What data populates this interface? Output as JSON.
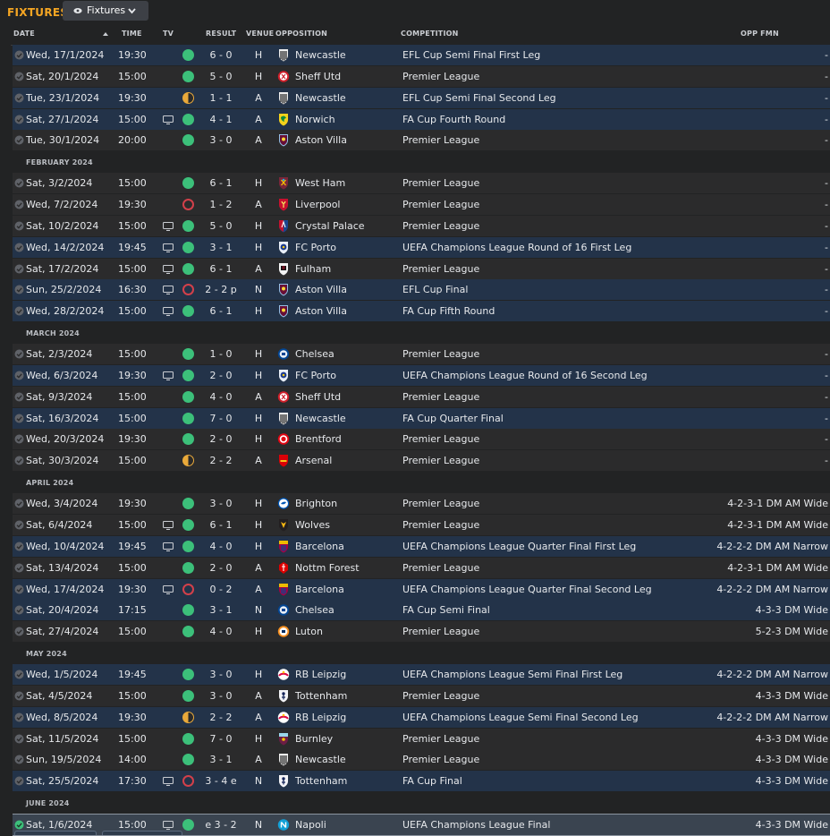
{
  "header": {
    "title": "FIXTURES",
    "view_label": "Fixtures"
  },
  "columns": {
    "date": "DATE",
    "time": "TIME",
    "tv": "TV",
    "result": "RESULT",
    "venue": "VENUE",
    "opposition": "OPPOSITION",
    "competition": "COMPETITION",
    "opp_fmn": "OPP FMN"
  },
  "colors": {
    "accent": "#f5a623",
    "win": "#3cc07a",
    "loss": "#d2404a",
    "draw": "#e9a93a",
    "highlight_row": "#233349"
  },
  "rows": [
    {
      "type": "match",
      "date": "Wed, 17/1/2024",
      "time": "19:30",
      "tv": false,
      "outcome": "win",
      "result": "6 - 0",
      "venue": "H",
      "opp": "Newcastle",
      "crest": "newcastle",
      "comp": "EFL Cup Semi Final First Leg",
      "fmn": "-",
      "hl": true
    },
    {
      "type": "match",
      "date": "Sat, 20/1/2024",
      "time": "15:00",
      "tv": false,
      "outcome": "win",
      "result": "5 - 0",
      "venue": "H",
      "opp": "Sheff Utd",
      "crest": "sheffutd",
      "comp": "Premier League",
      "fmn": "-",
      "hl": false
    },
    {
      "type": "match",
      "date": "Tue, 23/1/2024",
      "time": "19:30",
      "tv": false,
      "outcome": "draw",
      "result": "1 - 1",
      "venue": "A",
      "opp": "Newcastle",
      "crest": "newcastle",
      "comp": "EFL Cup Semi Final Second Leg",
      "fmn": "-",
      "hl": true
    },
    {
      "type": "match",
      "date": "Sat, 27/1/2024",
      "time": "15:00",
      "tv": true,
      "outcome": "win",
      "result": "4 - 1",
      "venue": "A",
      "opp": "Norwich",
      "crest": "norwich",
      "comp": "FA Cup Fourth Round",
      "fmn": "-",
      "hl": true
    },
    {
      "type": "match",
      "date": "Tue, 30/1/2024",
      "time": "20:00",
      "tv": false,
      "outcome": "win",
      "result": "3 - 0",
      "venue": "A",
      "opp": "Aston Villa",
      "crest": "villa",
      "comp": "Premier League",
      "fmn": "-",
      "hl": false
    },
    {
      "type": "month",
      "label": "FEBRUARY 2024"
    },
    {
      "type": "match",
      "date": "Sat, 3/2/2024",
      "time": "15:00",
      "tv": false,
      "outcome": "win",
      "result": "6 - 1",
      "venue": "H",
      "opp": "West Ham",
      "crest": "westham",
      "comp": "Premier League",
      "fmn": "-",
      "hl": false
    },
    {
      "type": "match",
      "date": "Wed, 7/2/2024",
      "time": "19:30",
      "tv": false,
      "outcome": "loss",
      "result": "1 - 2",
      "venue": "A",
      "opp": "Liverpool",
      "crest": "liverpool",
      "comp": "Premier League",
      "fmn": "-",
      "hl": false
    },
    {
      "type": "match",
      "date": "Sat, 10/2/2024",
      "time": "15:00",
      "tv": true,
      "outcome": "win",
      "result": "5 - 0",
      "venue": "H",
      "opp": "Crystal Palace",
      "crest": "palace",
      "comp": "Premier League",
      "fmn": "-",
      "hl": false
    },
    {
      "type": "match",
      "date": "Wed, 14/2/2024",
      "time": "19:45",
      "tv": true,
      "outcome": "win",
      "result": "3 - 1",
      "venue": "H",
      "opp": "FC Porto",
      "crest": "porto",
      "comp": "UEFA Champions League Round of 16 First Leg",
      "fmn": "-",
      "hl": true
    },
    {
      "type": "match",
      "date": "Sat, 17/2/2024",
      "time": "15:00",
      "tv": true,
      "outcome": "win",
      "result": "6 - 1",
      "venue": "A",
      "opp": "Fulham",
      "crest": "fulham",
      "comp": "Premier League",
      "fmn": "-",
      "hl": false
    },
    {
      "type": "match",
      "date": "Sun, 25/2/2024",
      "time": "16:30",
      "tv": true,
      "outcome": "loss",
      "result": "2 - 2 p",
      "venue": "N",
      "opp": "Aston Villa",
      "crest": "villa",
      "comp": "EFL Cup Final",
      "fmn": "-",
      "hl": true
    },
    {
      "type": "match",
      "date": "Wed, 28/2/2024",
      "time": "15:00",
      "tv": true,
      "outcome": "win",
      "result": "6 - 1",
      "venue": "H",
      "opp": "Aston Villa",
      "crest": "villa",
      "comp": "FA Cup Fifth Round",
      "fmn": "-",
      "hl": true
    },
    {
      "type": "month",
      "label": "MARCH 2024"
    },
    {
      "type": "match",
      "date": "Sat, 2/3/2024",
      "time": "15:00",
      "tv": false,
      "outcome": "win",
      "result": "1 - 0",
      "venue": "H",
      "opp": "Chelsea",
      "crest": "chelsea",
      "comp": "Premier League",
      "fmn": "-",
      "hl": false
    },
    {
      "type": "match",
      "date": "Wed, 6/3/2024",
      "time": "19:30",
      "tv": true,
      "outcome": "win",
      "result": "2 - 0",
      "venue": "H",
      "opp": "FC Porto",
      "crest": "porto",
      "comp": "UEFA Champions League Round of 16 Second Leg",
      "fmn": "-",
      "hl": true
    },
    {
      "type": "match",
      "date": "Sat, 9/3/2024",
      "time": "15:00",
      "tv": false,
      "outcome": "win",
      "result": "4 - 0",
      "venue": "A",
      "opp": "Sheff Utd",
      "crest": "sheffutd",
      "comp": "Premier League",
      "fmn": "-",
      "hl": false
    },
    {
      "type": "match",
      "date": "Sat, 16/3/2024",
      "time": "15:00",
      "tv": false,
      "outcome": "win",
      "result": "7 - 0",
      "venue": "H",
      "opp": "Newcastle",
      "crest": "newcastle",
      "comp": "FA Cup Quarter Final",
      "fmn": "-",
      "hl": true
    },
    {
      "type": "match",
      "date": "Wed, 20/3/2024",
      "time": "19:30",
      "tv": false,
      "outcome": "win",
      "result": "2 - 0",
      "venue": "H",
      "opp": "Brentford",
      "crest": "brentford",
      "comp": "Premier League",
      "fmn": "-",
      "hl": false
    },
    {
      "type": "match",
      "date": "Sat, 30/3/2024",
      "time": "15:00",
      "tv": false,
      "outcome": "draw",
      "result": "2 - 2",
      "venue": "A",
      "opp": "Arsenal",
      "crest": "arsenal",
      "comp": "Premier League",
      "fmn": "-",
      "hl": false
    },
    {
      "type": "month",
      "label": "APRIL 2024"
    },
    {
      "type": "match",
      "date": "Wed, 3/4/2024",
      "time": "19:30",
      "tv": false,
      "outcome": "win",
      "result": "3 - 0",
      "venue": "H",
      "opp": "Brighton",
      "crest": "brighton",
      "comp": "Premier League",
      "fmn": "4-2-3-1 DM AM Wide",
      "hl": false
    },
    {
      "type": "match",
      "date": "Sat, 6/4/2024",
      "time": "15:00",
      "tv": true,
      "outcome": "win",
      "result": "6 - 1",
      "venue": "H",
      "opp": "Wolves",
      "crest": "wolves",
      "comp": "Premier League",
      "fmn": "4-2-3-1 DM AM Wide",
      "hl": false
    },
    {
      "type": "match",
      "date": "Wed, 10/4/2024",
      "time": "19:45",
      "tv": true,
      "outcome": "win",
      "result": "4 - 0",
      "venue": "H",
      "opp": "Barcelona",
      "crest": "barcelona",
      "comp": "UEFA Champions League Quarter Final First Leg",
      "fmn": "4-2-2-2 DM AM Narrow",
      "hl": true
    },
    {
      "type": "match",
      "date": "Sat, 13/4/2024",
      "time": "15:00",
      "tv": false,
      "outcome": "win",
      "result": "2 - 0",
      "venue": "A",
      "opp": "Nottm Forest",
      "crest": "forest",
      "comp": "Premier League",
      "fmn": "4-2-3-1 DM AM Wide",
      "hl": false
    },
    {
      "type": "match",
      "date": "Wed, 17/4/2024",
      "time": "19:30",
      "tv": true,
      "outcome": "loss",
      "result": "0 - 2",
      "venue": "A",
      "opp": "Barcelona",
      "crest": "barcelona",
      "comp": "UEFA Champions League Quarter Final Second Leg",
      "fmn": "4-2-2-2 DM AM Narrow",
      "hl": true
    },
    {
      "type": "match",
      "date": "Sat, 20/4/2024",
      "time": "17:15",
      "tv": false,
      "outcome": "win",
      "result": "3 - 1",
      "venue": "N",
      "opp": "Chelsea",
      "crest": "chelsea",
      "comp": "FA Cup Semi Final",
      "fmn": "4-3-3 DM Wide",
      "hl": true
    },
    {
      "type": "match",
      "date": "Sat, 27/4/2024",
      "time": "15:00",
      "tv": false,
      "outcome": "win",
      "result": "4 - 0",
      "venue": "H",
      "opp": "Luton",
      "crest": "luton",
      "comp": "Premier League",
      "fmn": "5-2-3 DM Wide",
      "hl": false
    },
    {
      "type": "month",
      "label": "MAY 2024"
    },
    {
      "type": "match",
      "date": "Wed, 1/5/2024",
      "time": "19:45",
      "tv": false,
      "outcome": "win",
      "result": "3 - 0",
      "venue": "H",
      "opp": "RB Leipzig",
      "crest": "leipzig",
      "comp": "UEFA Champions League Semi Final First Leg",
      "fmn": "4-2-2-2 DM AM Narrow",
      "hl": true
    },
    {
      "type": "match",
      "date": "Sat, 4/5/2024",
      "time": "15:00",
      "tv": false,
      "outcome": "win",
      "result": "3 - 0",
      "venue": "A",
      "opp": "Tottenham",
      "crest": "spurs",
      "comp": "Premier League",
      "fmn": "4-3-3 DM Wide",
      "hl": false
    },
    {
      "type": "match",
      "date": "Wed, 8/5/2024",
      "time": "19:30",
      "tv": false,
      "outcome": "draw",
      "result": "2 - 2",
      "venue": "A",
      "opp": "RB Leipzig",
      "crest": "leipzig",
      "comp": "UEFA Champions League Semi Final Second Leg",
      "fmn": "4-2-2-2 DM AM Narrow",
      "hl": true
    },
    {
      "type": "match",
      "date": "Sat, 11/5/2024",
      "time": "15:00",
      "tv": false,
      "outcome": "win",
      "result": "7 - 0",
      "venue": "H",
      "opp": "Burnley",
      "crest": "burnley",
      "comp": "Premier League",
      "fmn": "4-3-3 DM Wide",
      "hl": false
    },
    {
      "type": "match",
      "date": "Sun, 19/5/2024",
      "time": "14:00",
      "tv": false,
      "outcome": "win",
      "result": "3 - 1",
      "venue": "A",
      "opp": "Newcastle",
      "crest": "newcastle",
      "comp": "Premier League",
      "fmn": "4-3-3 DM Wide",
      "hl": false
    },
    {
      "type": "match",
      "date": "Sat, 25/5/2024",
      "time": "17:30",
      "tv": true,
      "outcome": "loss",
      "result": "3 - 4 e",
      "venue": "N",
      "opp": "Tottenham",
      "crest": "spurs",
      "comp": "FA Cup Final",
      "fmn": "4-3-3 DM Wide",
      "hl": true
    },
    {
      "type": "month",
      "label": "JUNE 2024"
    },
    {
      "type": "match",
      "date": "Sat, 1/6/2024",
      "time": "15:00",
      "tv": true,
      "outcome": "win",
      "result": "e 3 - 2",
      "venue": "N",
      "opp": "Napoli",
      "crest": "napoli",
      "comp": "UEFA Champions League Final",
      "fmn": "4-3-3 DM Wide",
      "hl": false,
      "selected": true
    }
  ]
}
